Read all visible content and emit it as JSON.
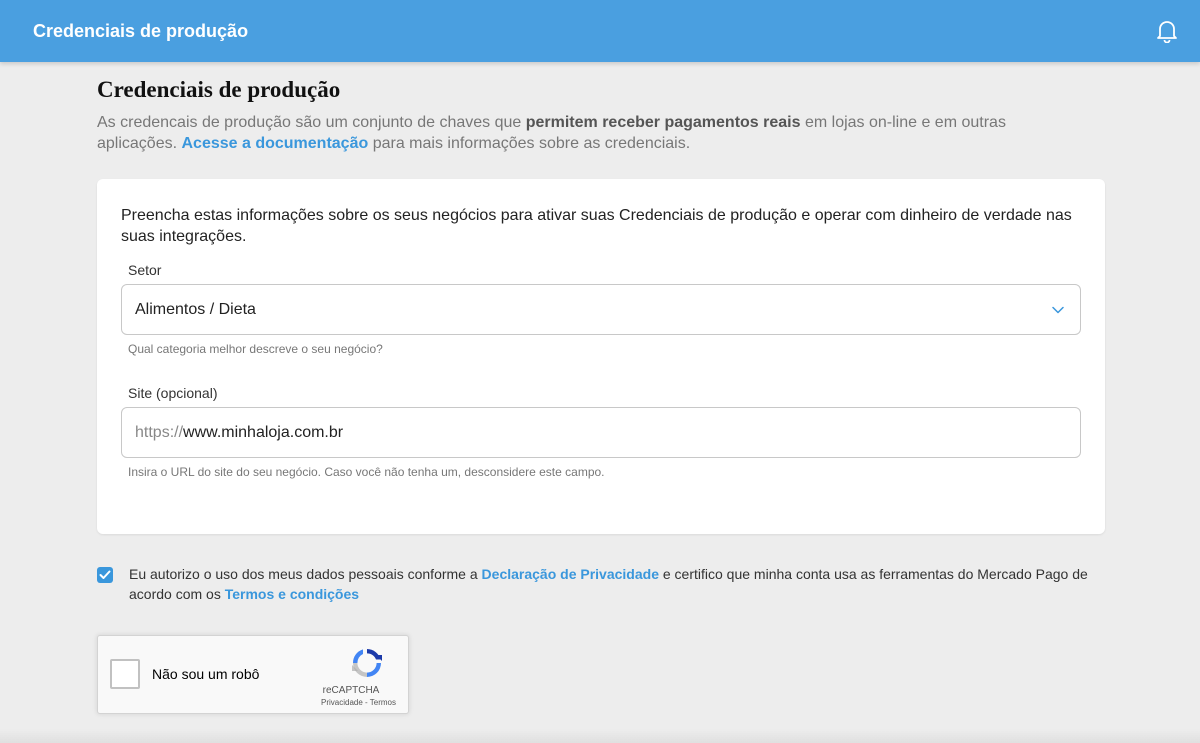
{
  "header": {
    "title": "Credenciais de produção",
    "bell_icon": "bell-icon",
    "background": "#4a9fe0"
  },
  "page": {
    "title": "Credenciais de produção",
    "desc_part1": "As credencais de produção são um conjunto de chaves que ",
    "desc_bold": "permitem receber pagamentos reais",
    "desc_part2": " em lojas on-line e em outras aplicações. ",
    "desc_link": "Acesse a documentação",
    "desc_part3": " para mais informações sobre as credenciais."
  },
  "form": {
    "intro": "Preencha estas informações sobre os seus negócios para ativar suas Credenciais de produção e operar com dinheiro de verdade nas suas integrações.",
    "sector": {
      "label": "Setor",
      "value": "Alimentos / Dieta",
      "help": "Qual categoria melhor descreve o seu negócio?",
      "icon": "chevron-down-icon"
    },
    "site": {
      "label": "Site (opcional)",
      "prefix": "https://",
      "value": "www.minhaloja.com.br",
      "help": "Insira o URL do site do seu negócio. Caso você não tenha um, desconsidere este campo."
    }
  },
  "consent": {
    "checked": true,
    "text1": "Eu autorizo o uso dos meus dados pessoais conforme a ",
    "link1": "Declaração de Privacidade",
    "text2": " e certifico que minha conta usa as ferramentas do Mercado Pago de acordo com os ",
    "link2": "Termos e condições"
  },
  "recaptcha": {
    "label": "Não sou um robô",
    "brand": "reCAPTCHA",
    "privacy": "Privacidade",
    "separator": " - ",
    "terms": "Termos"
  },
  "colors": {
    "accent": "#3a97dc",
    "page_bg": "#ededed"
  }
}
